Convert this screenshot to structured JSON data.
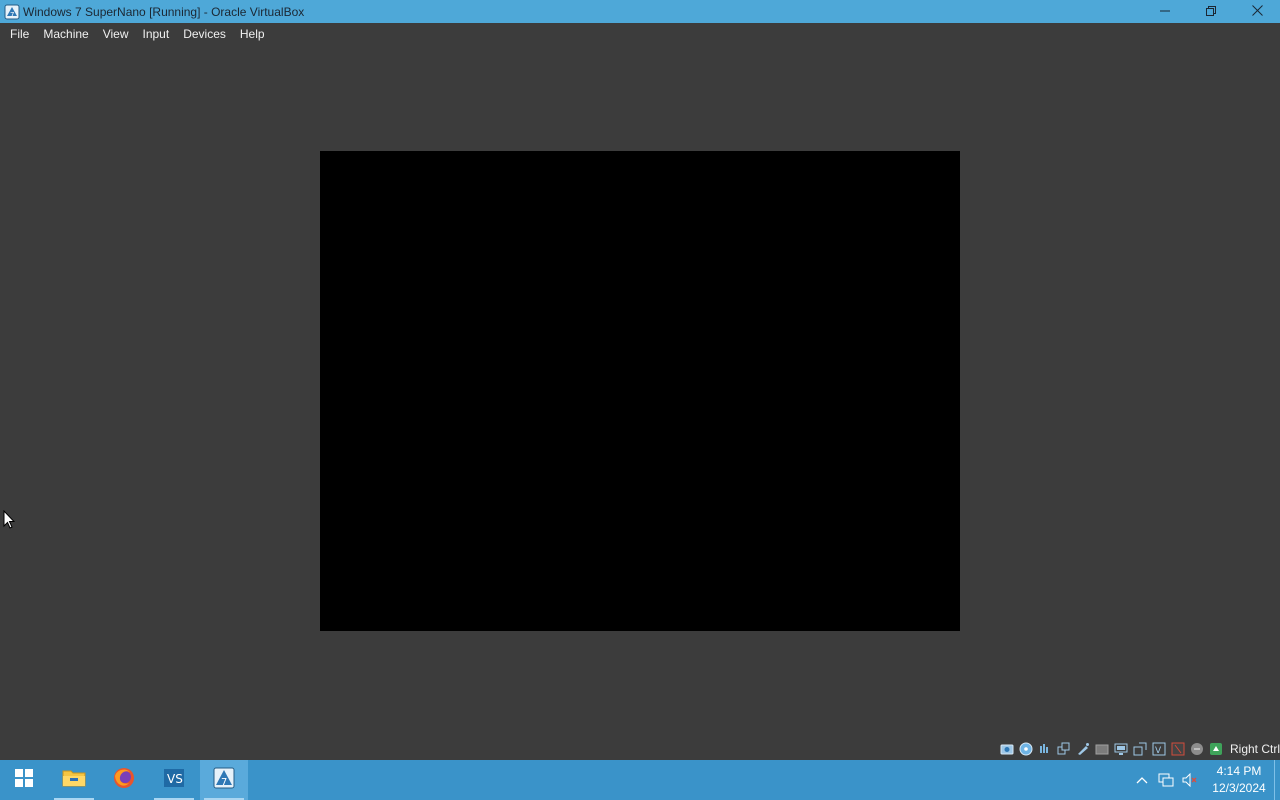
{
  "window": {
    "title": "Windows 7 SuperNano [Running] - Oracle VirtualBox",
    "controls": {
      "minimize": "minimize-icon",
      "restore": "restore-icon",
      "close": "close-icon"
    }
  },
  "menu": {
    "items": [
      {
        "label": "File"
      },
      {
        "label": "Machine"
      },
      {
        "label": "View"
      },
      {
        "label": "Input"
      },
      {
        "label": "Devices"
      },
      {
        "label": "Help"
      }
    ]
  },
  "statusbar": {
    "icons": [
      "hard-disk-icon",
      "optical-drive-icon",
      "audio-icon",
      "network-icon",
      "usb-icon",
      "shared-folders-icon",
      "display-icon",
      "video-capture-icon",
      "cpu-icon",
      "mouse-integration-icon",
      "keyboard-icon",
      "host-key-icon"
    ],
    "host_key": "Right Ctrl"
  },
  "taskbar": {
    "apps": [
      {
        "name": "file-explorer",
        "active": false
      },
      {
        "name": "firefox",
        "active": false
      },
      {
        "name": "visual-studio-code",
        "active": false
      },
      {
        "name": "virtualbox",
        "active": true
      }
    ],
    "clock": {
      "time": "4:14 PM",
      "date": "12/3/2024"
    }
  },
  "colors": {
    "titlebar": "#4ea8d8",
    "background": "#3c3c3c",
    "vm_screen": "#000000",
    "taskbar": "#3a93c9"
  }
}
